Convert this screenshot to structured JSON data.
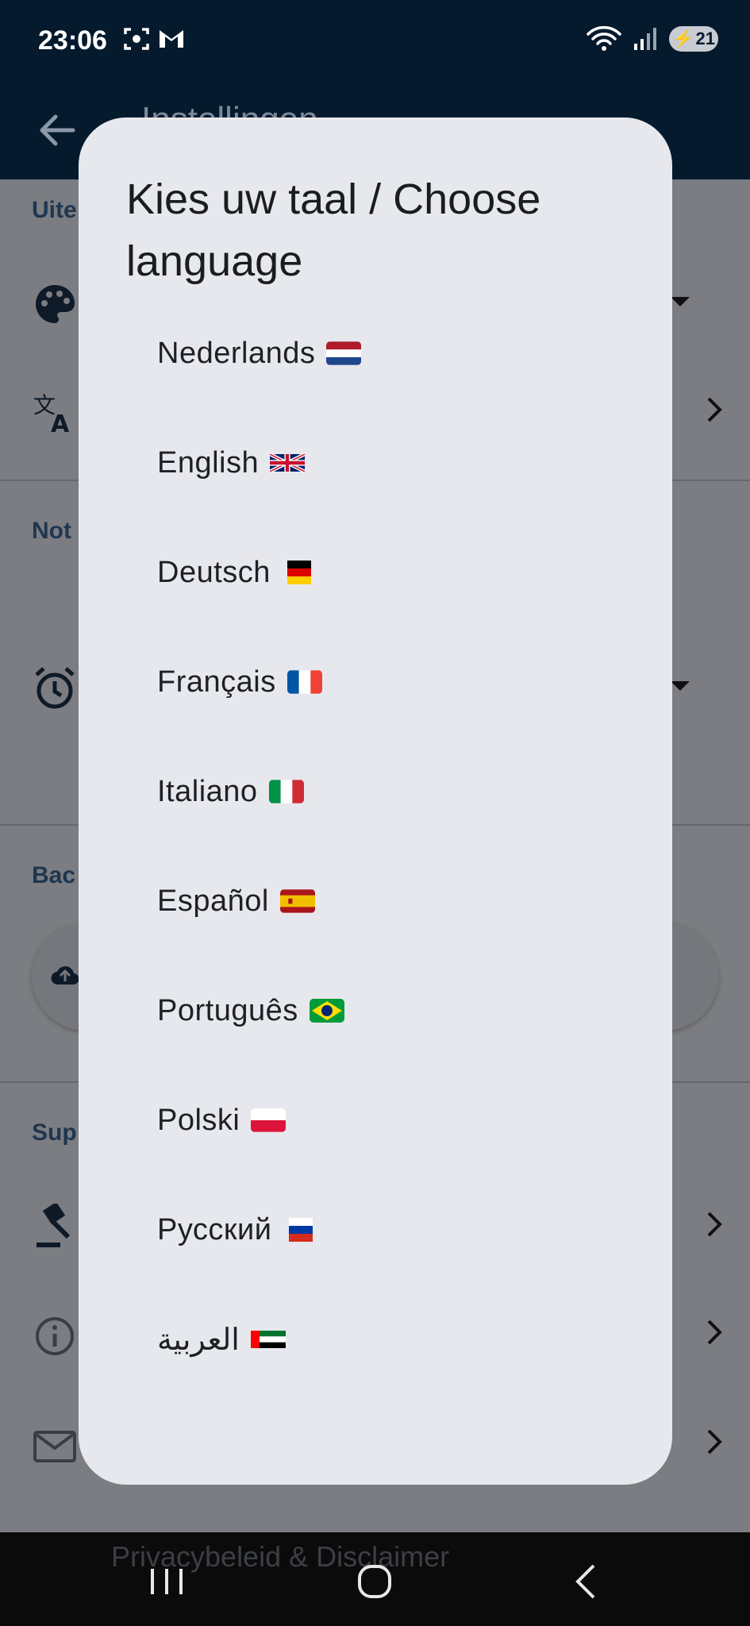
{
  "status_bar": {
    "time": "23:06",
    "left_icons": [
      "screen-capture-icon",
      "gmail-icon"
    ],
    "right_icons": [
      "wifi-icon",
      "signal-icon"
    ],
    "battery_level": "21"
  },
  "app_bar": {
    "back_icon": "arrow-left-icon",
    "title": "Instellingen"
  },
  "background": {
    "sections": [
      {
        "header": "Uite"
      },
      {
        "header": "Not"
      },
      {
        "header": "Bac"
      },
      {
        "header": "Sup"
      }
    ],
    "privacy_item": "Privacybeleid & Disclaimer"
  },
  "dialog": {
    "title": "Kies uw taal / Choose language",
    "languages": [
      {
        "label": "Nederlands",
        "flag": "nl-flag-icon"
      },
      {
        "label": "English",
        "flag": "gb-flag-icon"
      },
      {
        "label": "Deutsch",
        "flag": "de-flag-icon"
      },
      {
        "label": "Français",
        "flag": "fr-flag-icon"
      },
      {
        "label": "Italiano",
        "flag": "it-flag-icon"
      },
      {
        "label": "Español",
        "flag": "es-flag-icon"
      },
      {
        "label": "Português",
        "flag": "br-flag-icon"
      },
      {
        "label": "Polski",
        "flag": "pl-flag-icon"
      },
      {
        "label": "Русский",
        "flag": "ru-flag-icon"
      },
      {
        "label": "العربية",
        "flag": "ae-flag-icon"
      }
    ]
  },
  "nav_bar": {
    "buttons": [
      "recent-apps-icon",
      "home-icon",
      "back-nav-icon"
    ]
  }
}
